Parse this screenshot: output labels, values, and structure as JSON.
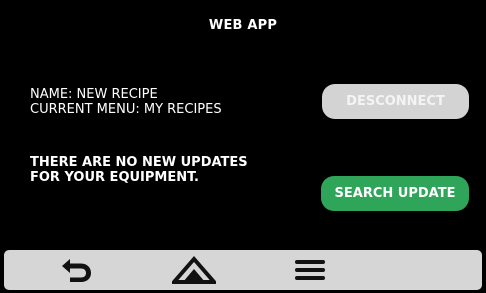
{
  "header": {
    "title": "WEB APP"
  },
  "info": {
    "name_line": "NAME: NEW RECIPE",
    "menu_line": "CURRENT MENU: MY RECIPES"
  },
  "updates": {
    "line1": "THERE ARE NO NEW UPDATES",
    "line2": "FOR YOUR EQUIPMENT."
  },
  "buttons": {
    "disconnect_label": "DESCONNECT",
    "search_update_label": "SEARCH UPDATE"
  },
  "nav": {
    "items": [
      {
        "icon": "back-arrow-icon"
      },
      {
        "icon": "home-icon"
      },
      {
        "icon": "hamburger-menu-icon"
      }
    ]
  },
  "colors": {
    "background": "#000000",
    "search_button": "#2fa55a",
    "disabled_button": "#d3d3d3",
    "navbar": "#d6d6d6",
    "icon": "#111111"
  }
}
